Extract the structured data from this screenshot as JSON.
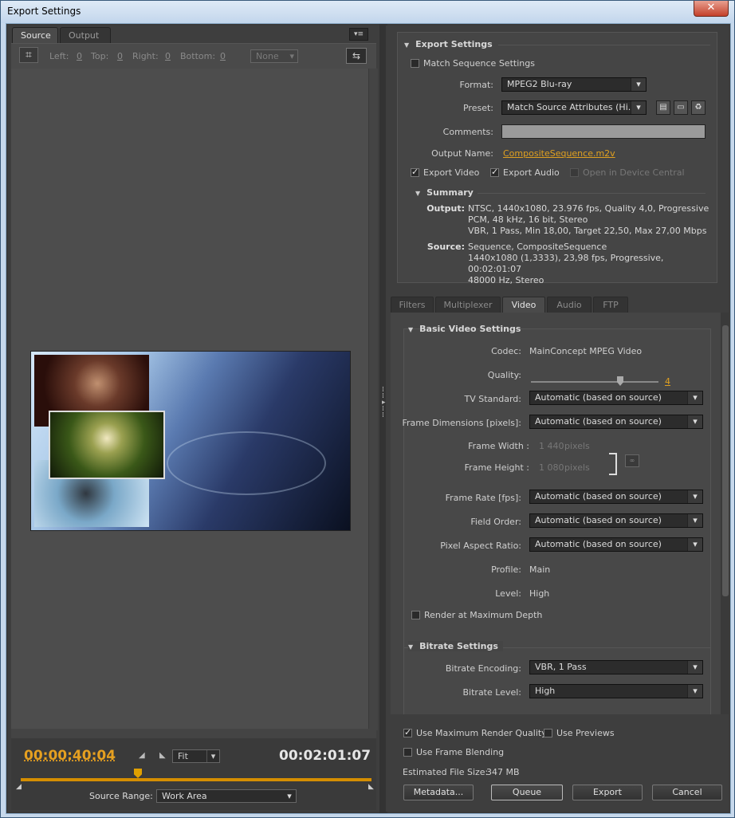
{
  "window": {
    "title": "Export Settings",
    "close_label": "✕"
  },
  "left": {
    "tabs": [
      "Source",
      "Output"
    ],
    "crop": {
      "left_label": "Left:",
      "left_val": "0",
      "top_label": "Top:",
      "top_val": "0",
      "right_label": "Right:",
      "right_val": "0",
      "bottom_label": "Bottom:",
      "bottom_val": "0",
      "preset": "None"
    },
    "timecode_current": "00:00:40:04",
    "timecode_duration": "00:02:01:07",
    "zoom": "Fit",
    "source_range_label": "Source Range:",
    "source_range": "Work Area"
  },
  "export": {
    "header": "Export Settings",
    "match_seq": "Match Sequence Settings",
    "format_label": "Format:",
    "format": "MPEG2 Blu-ray",
    "preset_label": "Preset:",
    "preset": "Match Source Attributes (Hi...",
    "comments_label": "Comments:",
    "output_name_label": "Output Name:",
    "output_name": "CompositeSequence.m2v",
    "export_video": "Export Video",
    "export_audio": "Export Audio",
    "device_central": "Open in Device Central",
    "summary_header": "Summary",
    "output_label": "Output:",
    "output_lines": [
      "NTSC, 1440x1080, 23.976 fps, Quality 4,0, Progressive",
      "PCM, 48 kHz, 16 bit, Stereo",
      "VBR, 1 Pass, Min 18,00, Target 22,50, Max 27,00 Mbps"
    ],
    "source_label": "Source:",
    "source_lines": [
      "Sequence, CompositeSequence",
      "1440x1080 (1,3333), 23,98 fps, Progressive, 00:02:01:07",
      "48000 Hz, Stereo"
    ]
  },
  "tabs": [
    "Filters",
    "Multiplexer",
    "Video",
    "Audio",
    "FTP"
  ],
  "video": {
    "header": "Basic Video Settings",
    "codec_label": "Codec:",
    "codec": "MainConcept MPEG Video",
    "quality_label": "Quality:",
    "quality": "4",
    "quality_fraction": 0.7,
    "tv_label": "TV Standard:",
    "tv": "Automatic (based on source)",
    "dims_label": "Frame Dimensions [pixels]:",
    "dims": "Automatic (based on source)",
    "fw_label": "Frame Width :",
    "fw": "1 440",
    "fh_label": "Frame Height :",
    "fh": "1 080",
    "pixels": "pixels",
    "fr_label": "Frame Rate [fps]:",
    "fr": "Automatic (based on source)",
    "fo_label": "Field Order:",
    "fo": "Automatic (based on source)",
    "par_label": "Pixel Aspect Ratio:",
    "par": "Automatic (based on source)",
    "profile_label": "Profile:",
    "profile": "Main",
    "level_label": "Level:",
    "level": "High",
    "render_max": "Render at Maximum Depth",
    "bitrate_header": "Bitrate Settings",
    "enc_label": "Bitrate Encoding:",
    "enc": "VBR, 1 Pass",
    "blevel_label": "Bitrate Level:",
    "blevel": "High"
  },
  "bottom": {
    "max_quality": "Use Maximum Render Quality",
    "previews": "Use Previews",
    "blending": "Use Frame Blending",
    "size_label": "Estimated File Size:",
    "size": "347 MB",
    "metadata": "Metadata...",
    "queue": "Queue",
    "export": "Export",
    "cancel": "Cancel"
  }
}
